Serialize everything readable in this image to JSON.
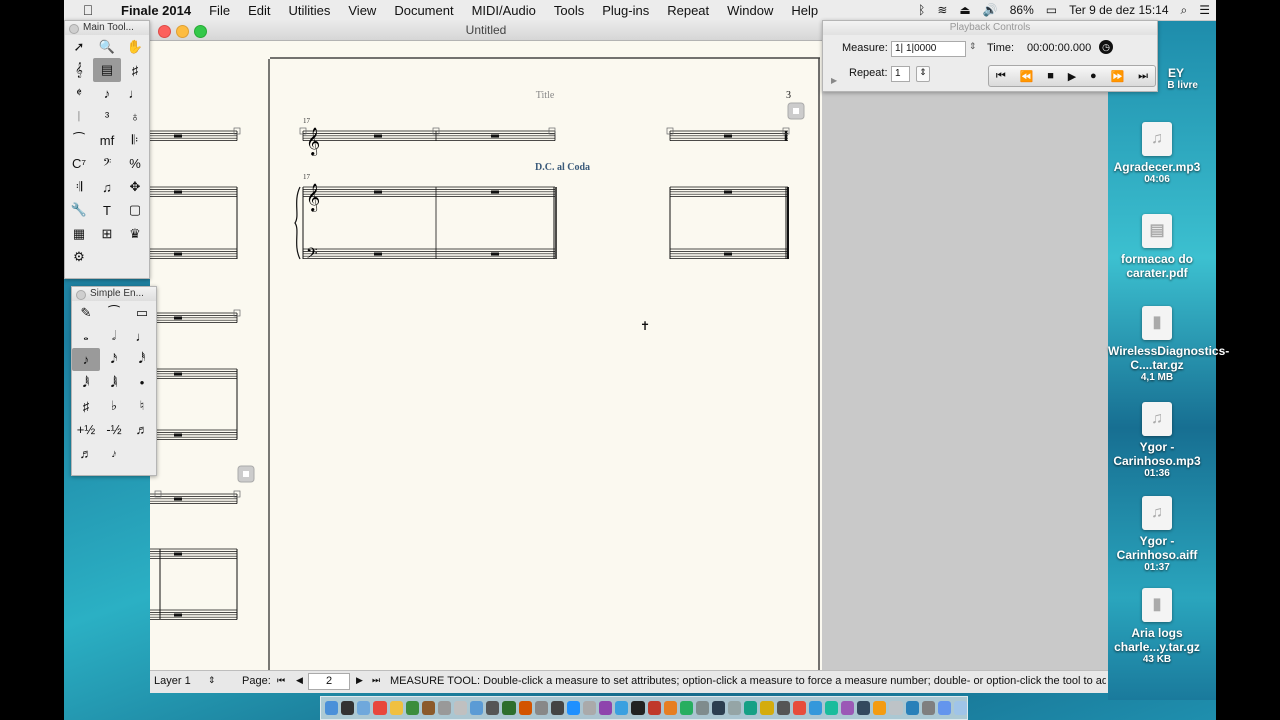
{
  "menubar": {
    "app_name": "Finale 2014",
    "items": [
      "File",
      "Edit",
      "Utilities",
      "View",
      "Document",
      "MIDI/Audio",
      "Tools",
      "Plug-ins",
      "Repeat",
      "Window",
      "Help"
    ],
    "battery": "86%",
    "clock": "Ter 9 de dez  15:14"
  },
  "window": {
    "title": "Untitled"
  },
  "score": {
    "title": "Title",
    "page_number": "3",
    "coda_text": "D.C. al Coda",
    "measure_num_a": "17",
    "measure_num_b": "17",
    "colors": {
      "paper": "#fbf9f0",
      "text_blue": "#3a5a7a",
      "ink": "#111111"
    }
  },
  "main_tool": {
    "title": "Main Tool...",
    "tools": [
      "selection-arrow",
      "zoom",
      "hand-grabber",
      "clef",
      "staff",
      "key-signature",
      "time-signature",
      "simple-entry",
      "speedy-entry",
      "hyper-scribe",
      "tuplet",
      "articulation",
      "smart-shape",
      "expression",
      "repeat",
      "chord",
      "lyrics",
      "percent-measure",
      "mirror",
      "graphics",
      "note-mover",
      "special-tools",
      "text",
      "page-layout",
      "mixer",
      "resize",
      "measure-tool",
      "ossia"
    ],
    "glyphs": [
      "➚",
      "🔍",
      "✋",
      "𝄞",
      "▤",
      "♯",
      "𝄵",
      "♪",
      "♩",
      "𝄀",
      "³",
      "♁",
      "⁀",
      "mf",
      "𝄆",
      "C⁷",
      "𝄢",
      "%",
      "𝄇",
      "♫",
      "✥",
      "🔧",
      "T",
      "▢",
      "▦",
      "⊞",
      "♛",
      "⚙"
    ]
  },
  "simple_entry": {
    "title": "Simple En...",
    "tools": [
      "eraser",
      "tie",
      "rest",
      "whole-note",
      "half-note",
      "quarter-note",
      "eighth-note",
      "sixteenth-note",
      "thirty-second-note",
      "sixty-fourth-note",
      "128th-note",
      "dot",
      "sharp",
      "flat",
      "natural",
      "half-step-up",
      "half-step-down",
      "tuplet-notes",
      "grace-note",
      "cue-note"
    ],
    "glyphs": [
      "✎",
      "⁀",
      "▭",
      "𝅝",
      "𝅗𝅥",
      "♩",
      "♪",
      "𝅘𝅥𝅯",
      "𝅘𝅥𝅰",
      "𝅘𝅥𝅱",
      "𝅘𝅥𝅲",
      "•",
      "♯",
      "♭",
      "♮",
      "+½",
      "-½",
      "♬",
      "♬",
      "𝆔"
    ]
  },
  "playback": {
    "title": "Playback Controls",
    "measure_label": "Measure:",
    "measure_value": "1| 1|0000",
    "time_label": "Time:",
    "time_value": "00:00:00.000",
    "repeat_label": "Repeat:",
    "repeat_value": "1",
    "transport": [
      "⏮",
      "⏪",
      "■",
      "▶",
      "●",
      "⏩",
      "⏭"
    ]
  },
  "statusbar": {
    "layer": "Layer 1",
    "page_label": "Page:",
    "page_value": "2",
    "message": "MEASURE TOOL: Double-click a measure to set attributes; option-click a measure to force a measure number; double- or option-click the tool to ad..."
  },
  "desktop": {
    "partial_top_label": "EY",
    "partial_top_sub": "B livre",
    "files": [
      {
        "name": "Agradecer.mp3",
        "sub": "04:06",
        "kind": "audio"
      },
      {
        "name": "formacao do carater.pdf",
        "sub": "",
        "kind": "document"
      },
      {
        "name": "WirelessDiagnostics-C....tar.gz",
        "sub": "4,1 MB",
        "kind": "archive"
      },
      {
        "name": "Ygor - Carinhoso.mp3",
        "sub": "01:36",
        "kind": "audio"
      },
      {
        "name": "Ygor - Carinhoso.aiff",
        "sub": "01:37",
        "kind": "audio"
      },
      {
        "name": "Aria logs charle...y.tar.gz",
        "sub": "43 KB",
        "kind": "archive"
      }
    ]
  }
}
